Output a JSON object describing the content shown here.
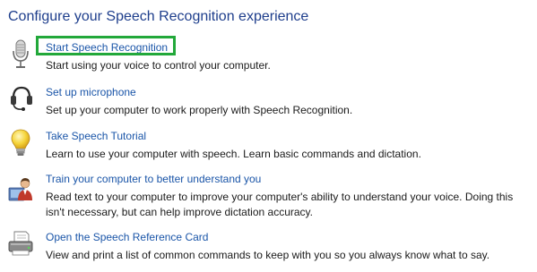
{
  "page": {
    "title": "Configure your Speech Recognition experience"
  },
  "tasks": [
    {
      "link": "Start Speech Recognition",
      "description": "Start using your voice to control your computer.",
      "icon": "microphone-icon"
    },
    {
      "link": "Set up microphone",
      "description": "Set up your computer to work properly with Speech Recognition.",
      "icon": "headset-icon"
    },
    {
      "link": "Take Speech Tutorial",
      "description": "Learn to use your computer with speech.  Learn basic commands and dictation.",
      "icon": "lightbulb-icon"
    },
    {
      "link": "Train your computer to better understand you",
      "description": "Read text to your computer to improve your computer's ability to understand your voice.  Doing this isn't necessary, but can help improve dictation accuracy.",
      "icon": "user-training-icon"
    },
    {
      "link": "Open the Speech Reference Card",
      "description": "View and print a list of common commands to keep with you so you always know what to say.",
      "icon": "printer-icon"
    }
  ],
  "colors": {
    "title": "#1e3e8c",
    "link": "#1a55a8",
    "highlight": "#22a83a"
  }
}
